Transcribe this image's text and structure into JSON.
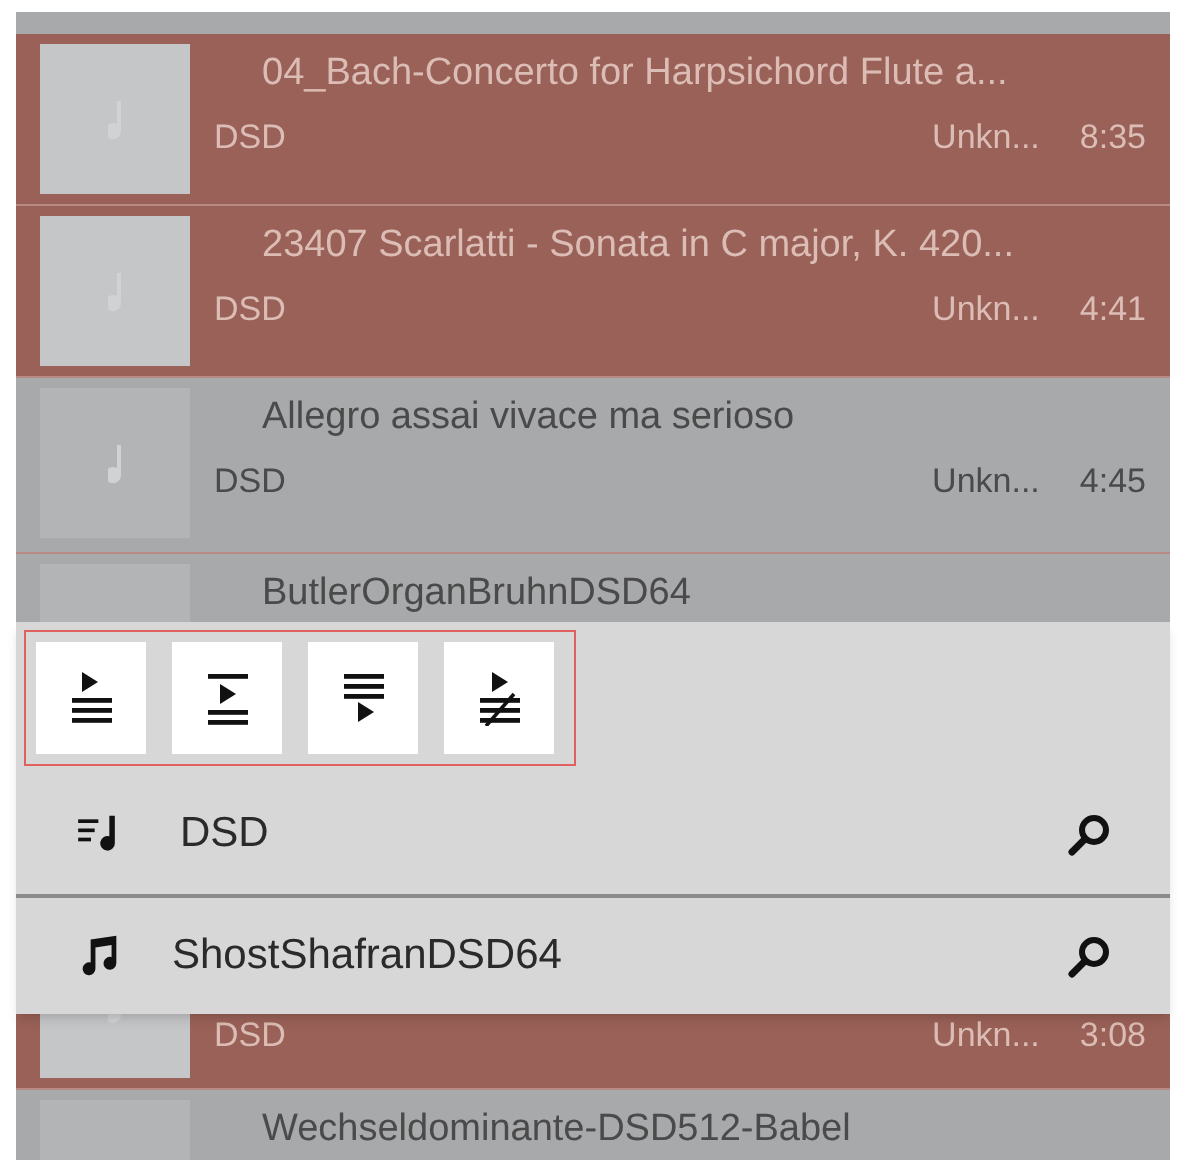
{
  "tracks": [
    {
      "title": "04_Bach-Concerto for Harpsichord Flute a...",
      "format": "DSD",
      "artist": "Unkn...",
      "duration": "8:35",
      "selected": true
    },
    {
      "title": "23407 Scarlatti - Sonata in C major, K. 420...",
      "format": "DSD",
      "artist": "Unkn...",
      "duration": "4:41",
      "selected": true
    },
    {
      "title": "Allegro assai vivace ma serioso",
      "format": "DSD",
      "artist": "Unkn...",
      "duration": "4:45",
      "selected": false
    },
    {
      "title": "ButlerOrganBruhnDSD64",
      "selected": false
    },
    {
      "format": "DSD",
      "artist": "Unkn...",
      "duration": "3:08",
      "selected": true
    },
    {
      "title": "Wechseldominante-DSD512-Babel",
      "selected": false
    }
  ],
  "popup": {
    "actions": [
      {
        "kind": "play_now"
      },
      {
        "kind": "play_next"
      },
      {
        "kind": "add_last"
      },
      {
        "kind": "replace"
      }
    ],
    "items": [
      {
        "kind": "playlist",
        "label": "DSD"
      },
      {
        "kind": "track",
        "label": "ShostShafranDSD64"
      }
    ]
  }
}
